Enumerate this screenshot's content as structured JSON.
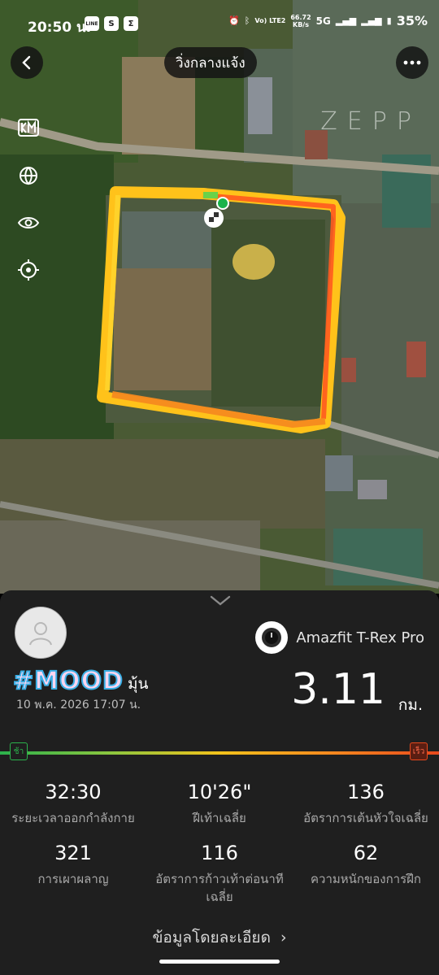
{
  "status_bar": {
    "time": "20:50 น.",
    "apps": [
      "LINE",
      "S",
      "Σ"
    ],
    "network_line1": "Vo) LTE2",
    "speed": "66.72",
    "speed_unit": "KB/s",
    "network": "5G",
    "battery": "35%"
  },
  "header": {
    "title": "วิ่งกลางแจ้ง",
    "back_icon": "back-arrow-icon",
    "more_icon": "more-dots-icon"
  },
  "map": {
    "watermark": "ZEPP",
    "tools": [
      "km-marker-icon",
      "globe-icon",
      "eye-icon",
      "locate-icon"
    ],
    "route_colors": [
      "#ffc21a",
      "#f58a1f",
      "#ff5a1f"
    ]
  },
  "summary": {
    "device_name": "Amazfit T-Rex Pro",
    "user_name": "#MOOD",
    "user_name_suffix": "มุ้น",
    "datetime": "10 พ.ค. 2026 17:07 น.",
    "distance": "3.11",
    "distance_unit": "กม.",
    "pace_slow_label": "ช้า",
    "pace_fast_label": "เร็ว",
    "stats": [
      {
        "value": "32:30",
        "label": "ระยะเวลาออกกำลังกาย"
      },
      {
        "value": "10'26\"",
        "label": "ฝีเท้าเฉลี่ย"
      },
      {
        "value": "136",
        "label": "อัตราการเต้นหัวใจเฉลี่ย"
      },
      {
        "value": "321",
        "label": "การเผาผลาญ"
      },
      {
        "value": "116",
        "label": "อัตราการก้าวเท้าต่อนาที เฉลี่ย"
      },
      {
        "value": "62",
        "label": "ความหนักของการฝึก"
      }
    ],
    "details_link": "ข้อมูลโดยละเอียด"
  }
}
